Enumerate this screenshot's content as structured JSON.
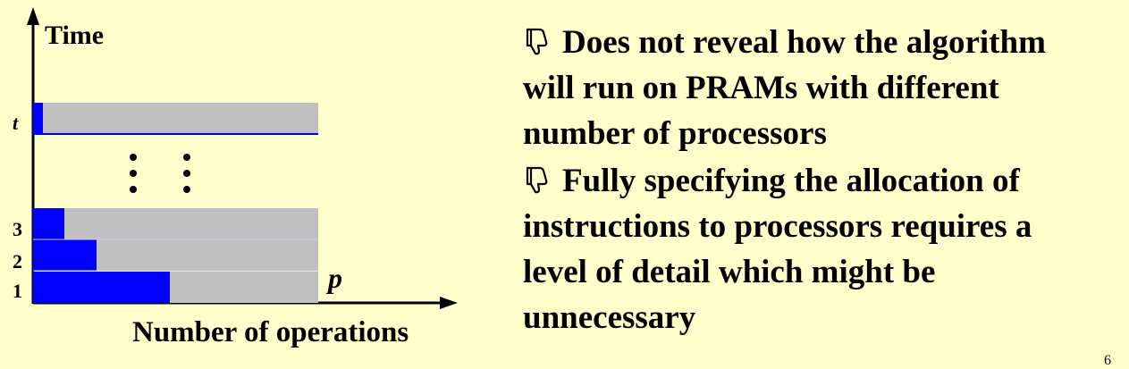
{
  "diagram": {
    "y_axis_label": "Time",
    "x_axis_label": "Number of operations",
    "p_label": "p",
    "row_labels": {
      "top": "t",
      "bottom": [
        "1",
        "2",
        "3"
      ]
    },
    "bars_blue_fraction": {
      "row_1": 0.49,
      "row_2": 0.22,
      "row_3": 0.11,
      "row_t": 0.03
    },
    "colors": {
      "background": "#ffffcc",
      "bar_filled": "#0000ff",
      "bar_remaining": "#c0c0c0",
      "axis": "#000000"
    }
  },
  "bullets": [
    {
      "icon": "thumbs-down-icon",
      "lines": [
        "Does not reveal how the algorithm",
        "will run on PRAMs with different",
        "number of processors"
      ]
    },
    {
      "icon": "thumbs-down-icon",
      "lines": [
        "Fully specifying the allocation of",
        "instructions to processors requires a",
        "level of detail which might be",
        "unnecessary"
      ]
    }
  ],
  "page_number": "6"
}
